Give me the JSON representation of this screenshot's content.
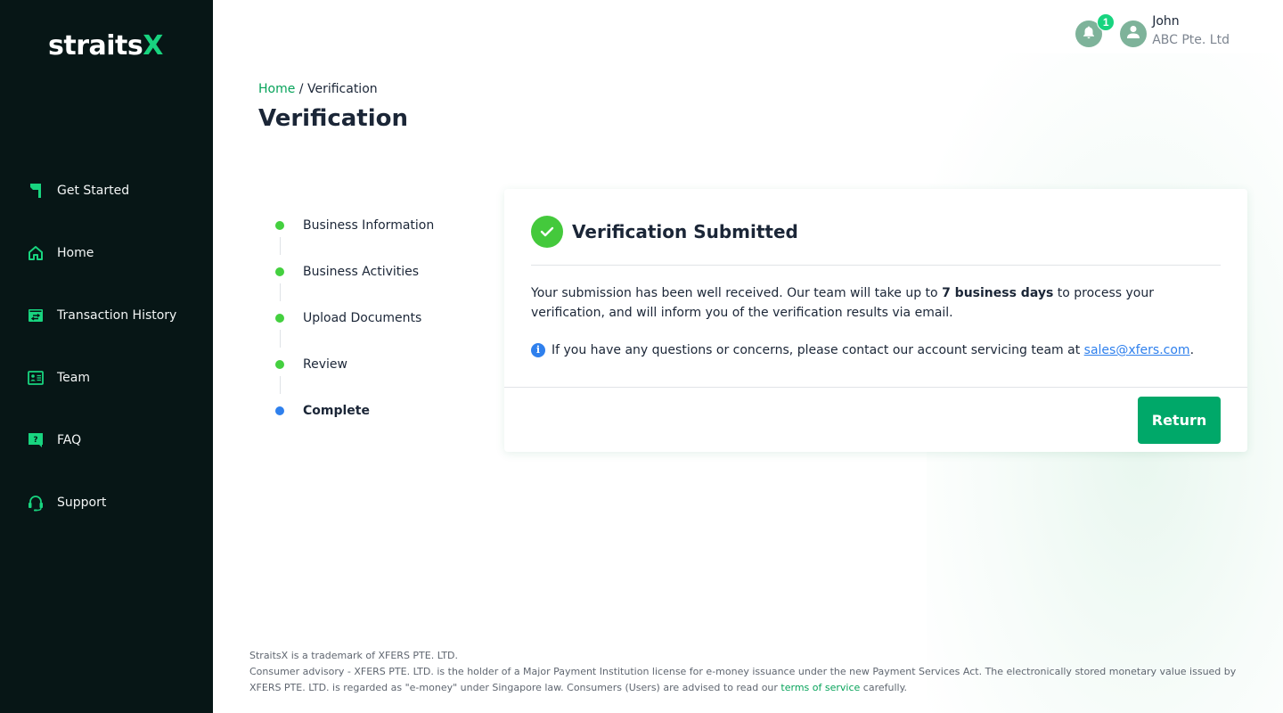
{
  "brand": {
    "logo_main": "straits",
    "logo_accent": "X",
    "accent_color": "#18d47f"
  },
  "sidebar": {
    "items": [
      {
        "label": "Get Started",
        "icon": "flag-icon"
      },
      {
        "label": "Home",
        "icon": "home-icon"
      },
      {
        "label": "Transaction History",
        "icon": "transaction-icon"
      },
      {
        "label": "Team",
        "icon": "id-card-icon"
      },
      {
        "label": "FAQ",
        "icon": "question-chat-icon"
      },
      {
        "label": "Support",
        "icon": "headset-icon"
      }
    ]
  },
  "header": {
    "notification_count": "1",
    "user_name": "John",
    "user_company": "ABC Pte. Ltd"
  },
  "breadcrumb": {
    "home": "Home",
    "separator": " / ",
    "current": "Verification"
  },
  "page": {
    "title": "Verification"
  },
  "stepper": {
    "steps": [
      {
        "label": "Business Information",
        "status": "done"
      },
      {
        "label": "Business Activities",
        "status": "done"
      },
      {
        "label": "Upload Documents",
        "status": "done"
      },
      {
        "label": "Review",
        "status": "done"
      },
      {
        "label": "Complete",
        "status": "current"
      }
    ]
  },
  "card": {
    "title": "Verification Submitted",
    "message_pre": "Your submission has been well received. Our team will take up to ",
    "message_bold": "7 business days",
    "message_post": " to process your verification, and will inform you of the verification results via email.",
    "info_pre": "If you have any questions or concerns, please contact our account servicing team at ",
    "info_email": "sales@xfers.com",
    "info_post": ".",
    "return_label": "Return"
  },
  "footer": {
    "line1": "StraitsX is a trademark of XFERS PTE. LTD.",
    "line2_pre": "Consumer advisory - XFERS PTE. LTD. is the holder of a Major Payment Institution license for e-money issuance under the new Payment Services Act. The electronically stored monetary value issued by XFERS PTE. LTD. is regarded as \"e-money\" under Singapore law. Consumers (Users) are advised to read our ",
    "terms_link": "terms of service",
    "line2_post": " carefully."
  }
}
